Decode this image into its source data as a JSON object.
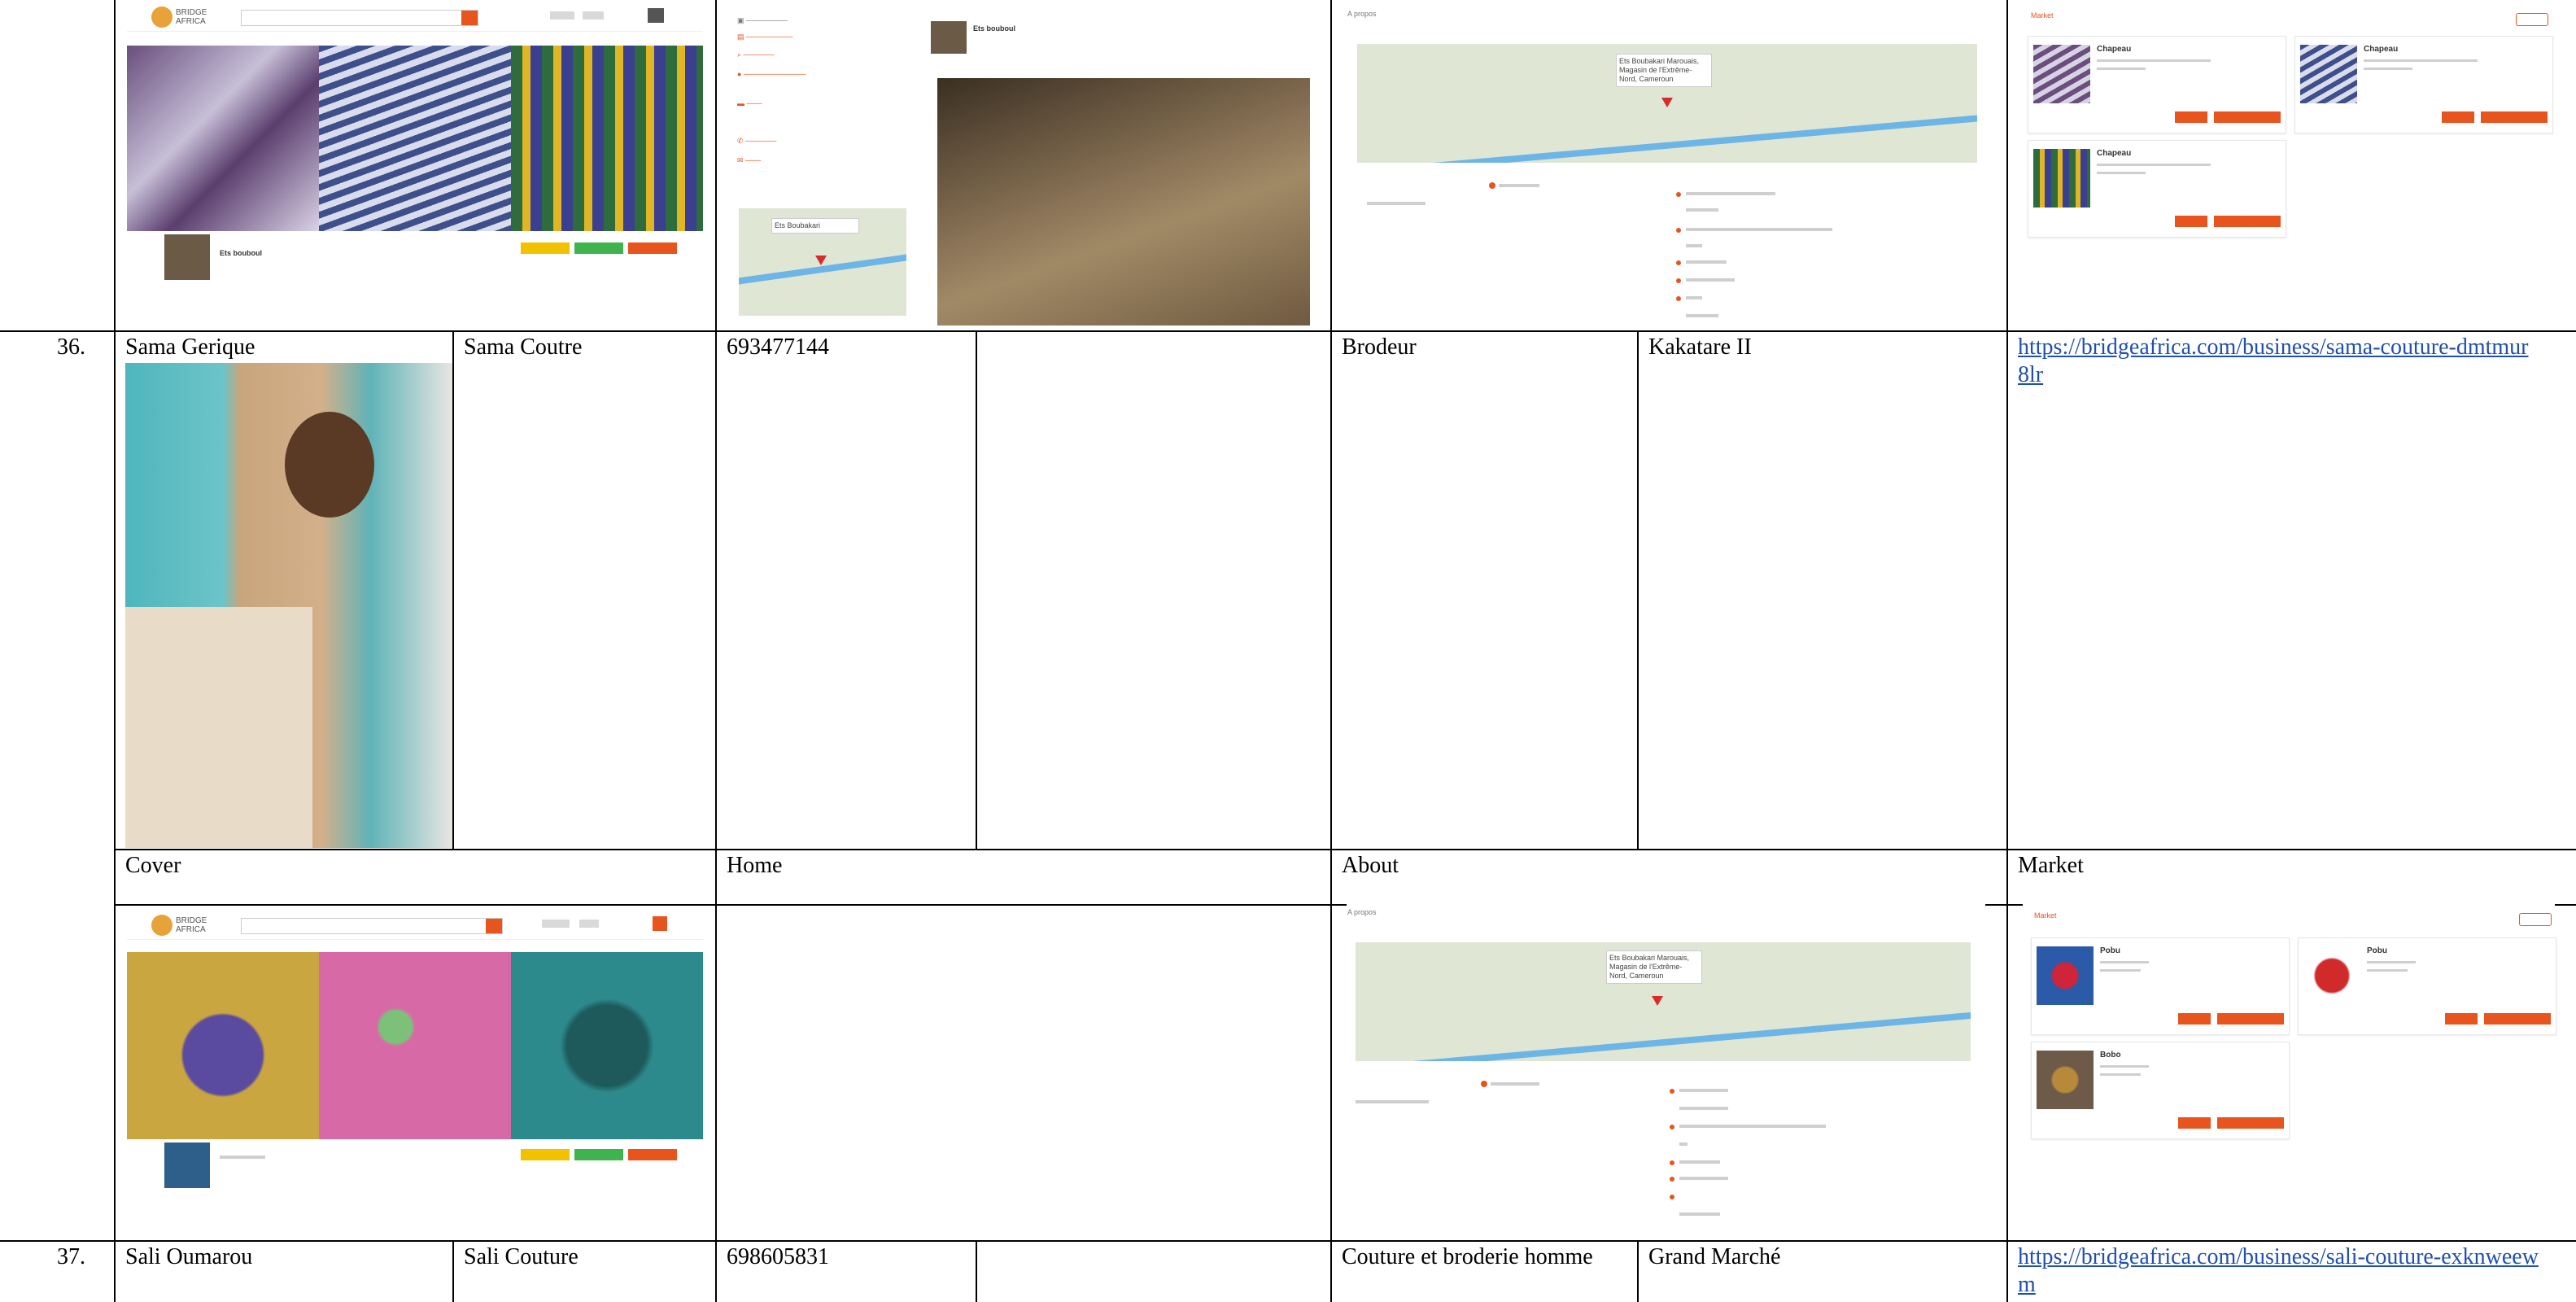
{
  "rows": [
    {
      "number": "36.",
      "name": "Sama Gerique",
      "business": "Sama Coutre",
      "phone": "693477144",
      "activity": "Brodeur",
      "location": "Kakatare II",
      "url": "https://bridgeafrica.com/business/sama-couture-dmtmur8lr"
    },
    {
      "number": "37.",
      "name": "Sali Oumarou",
      "business": "Sali Couture",
      "phone": "698605831",
      "activity": "Couture et broderie homme",
      "location": "Grand Marché",
      "url": "https://bridgeafrica.com/business/sali-couture-exknweewm"
    }
  ],
  "section_labels": {
    "cover": "Cover",
    "home": "Home",
    "about": "About",
    "market": "Market"
  },
  "previous": {
    "profile_name": "Ets bouboul",
    "home_card_title": "Ets bouboul",
    "map_popup": "Ets Boubakari Marouais, Magasin de l'Extrême-Nord, Cameroun",
    "products": [
      {
        "title": "Chapeau"
      },
      {
        "title": "Chapeau"
      },
      {
        "title": "Chapeau"
      }
    ]
  },
  "current": {
    "map_popup": "Ets Boubakari Marouais, Magasin de l'Extrême-Nord, Cameroun",
    "about_heading": "A propos",
    "market_heading": "Market",
    "products": [
      {
        "title": "Pobu"
      },
      {
        "title": "Pobu"
      },
      {
        "title": "Bobo"
      }
    ]
  },
  "colors": {
    "brand_orange": "#e8541e",
    "brand_green": "#3fb34f",
    "brand_yellow": "#f2c200",
    "link_blue": "#1f4fb0",
    "map_water": "#6db5e6"
  },
  "icons": [
    "search-icon",
    "location-pin-icon",
    "phone-icon",
    "email-icon",
    "globe-icon",
    "store-icon"
  ]
}
